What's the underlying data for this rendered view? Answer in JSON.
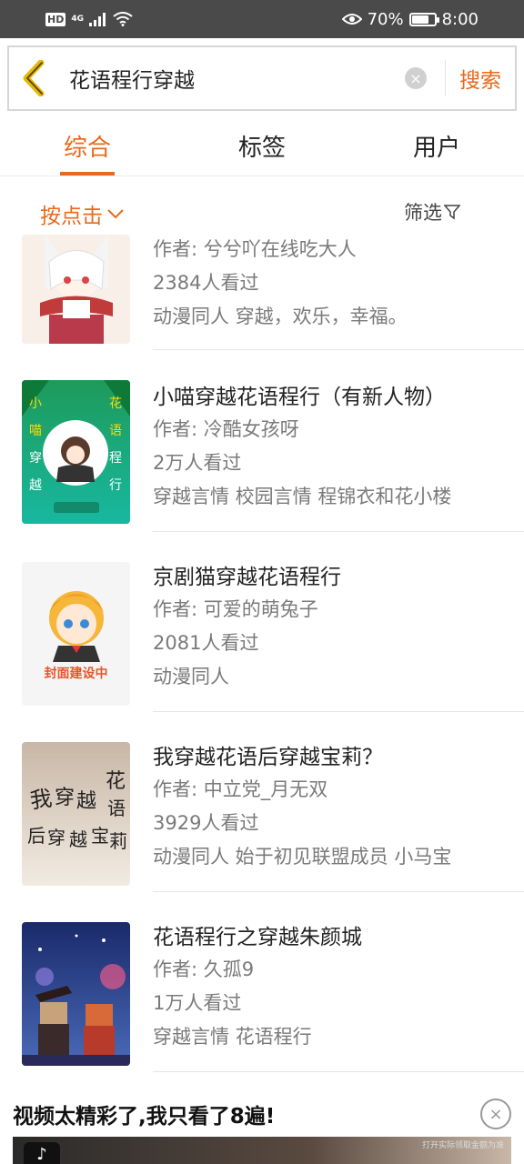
{
  "status_bar": {
    "hd": "HD",
    "network": "4G",
    "battery_text": "70%",
    "battery_level": 0.7,
    "time": "8:00"
  },
  "search": {
    "query": "花语程行穿越",
    "button_label": "搜索"
  },
  "tabs": [
    {
      "label": "综合",
      "active": true
    },
    {
      "label": "标签",
      "active": false
    },
    {
      "label": "用户",
      "active": false
    }
  ],
  "filter": {
    "sort_label": "按点击",
    "filter_label": "筛选"
  },
  "results": [
    {
      "title": "",
      "author": "作者: 兮兮吖在线吃大人",
      "views": "2384人看过",
      "tags": "动漫同人 穿越，欢乐，幸福。"
    },
    {
      "title": "小喵穿越花语程行（有新人物）",
      "author": "作者: 冷酷女孩呀",
      "views": "2万人看过",
      "tags": "穿越言情 校园言情 程锦衣和花小楼"
    },
    {
      "title": "京剧猫穿越花语程行",
      "author": "作者: 可爱的萌兔子",
      "views": "2081人看过",
      "tags": "动漫同人",
      "cover_text": "封面建设中"
    },
    {
      "title": "我穿越花语后穿越宝莉？",
      "author": "作者: 中立党_月无双",
      "views": "3929人看过",
      "tags": "动漫同人 始于初见联盟成员 小马宝"
    },
    {
      "title": "花语程行之穿越朱颜城",
      "author": "作者: 久孤9",
      "views": "1万人看过",
      "tags": "穿越言情 花语程行"
    }
  ],
  "cover_art": {
    "cover2_chars": [
      "小",
      "喵",
      "穿",
      "越",
      "花",
      "语",
      "程",
      "行"
    ],
    "cover4_chars": [
      "我",
      "穿",
      "越",
      "花",
      "语",
      "后",
      "穿",
      "越",
      "宝",
      "莉"
    ]
  },
  "ad": {
    "text": "视频太精彩了,我只看了8遍!",
    "notice": "打开实际领取金额为准"
  },
  "colors": {
    "accent": "#e86a1c",
    "status_bar": "#4a4a4a",
    "text_primary": "#222222",
    "text_secondary": "#7a7a7a"
  }
}
